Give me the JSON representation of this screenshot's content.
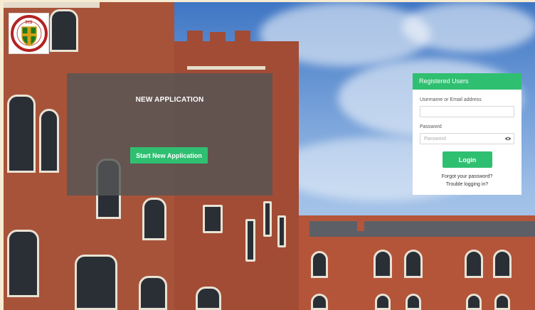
{
  "panel": {
    "title": "NEW APPLICATION",
    "start_button": "Start New Application"
  },
  "login": {
    "header": "Registered Users",
    "username_label": "Username or Email address",
    "username_value": "",
    "password_label": "Password",
    "password_placeholder": "Password",
    "login_button": "Login",
    "forgot_link": "Forgot your password?",
    "trouble_link": "Trouble logging in?"
  },
  "logo": {
    "text": "IHS"
  },
  "colors": {
    "accent": "#2fbf71",
    "panel_overlay": "rgba(85,85,85,0.82)"
  },
  "icons": {
    "password_toggle": "eye-icon"
  }
}
